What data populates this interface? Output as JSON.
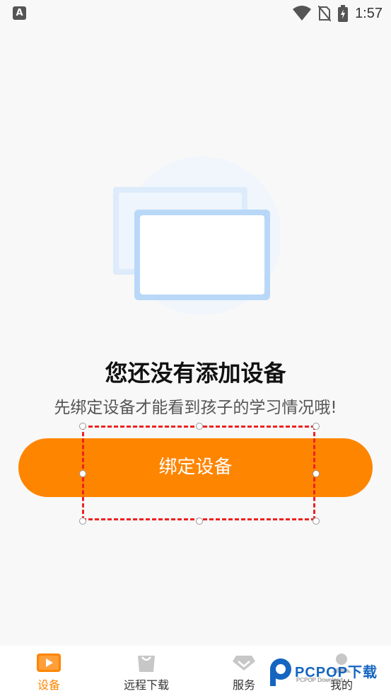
{
  "status_bar": {
    "time": "1:57",
    "app_icon_glyph": "A"
  },
  "empty_state": {
    "title": "您还没有添加设备",
    "subtitle": "先绑定设备才能看到孩子的学习情况哦!",
    "bind_button_label": "绑定设备"
  },
  "tabs": [
    {
      "label": "设备",
      "icon": "device-play-icon",
      "active": true
    },
    {
      "label": "远程下载",
      "icon": "shopping-bag-icon",
      "active": false
    },
    {
      "label": "服务",
      "icon": "diamond-icon",
      "active": false
    },
    {
      "label": "我的",
      "icon": "profile-icon",
      "active": false
    }
  ],
  "watermark": {
    "brand": "PCPOP下载",
    "sub": "PCPOP Download"
  },
  "colors": {
    "accent": "#fe8500",
    "illustration_blue": "#b9d8f8"
  }
}
